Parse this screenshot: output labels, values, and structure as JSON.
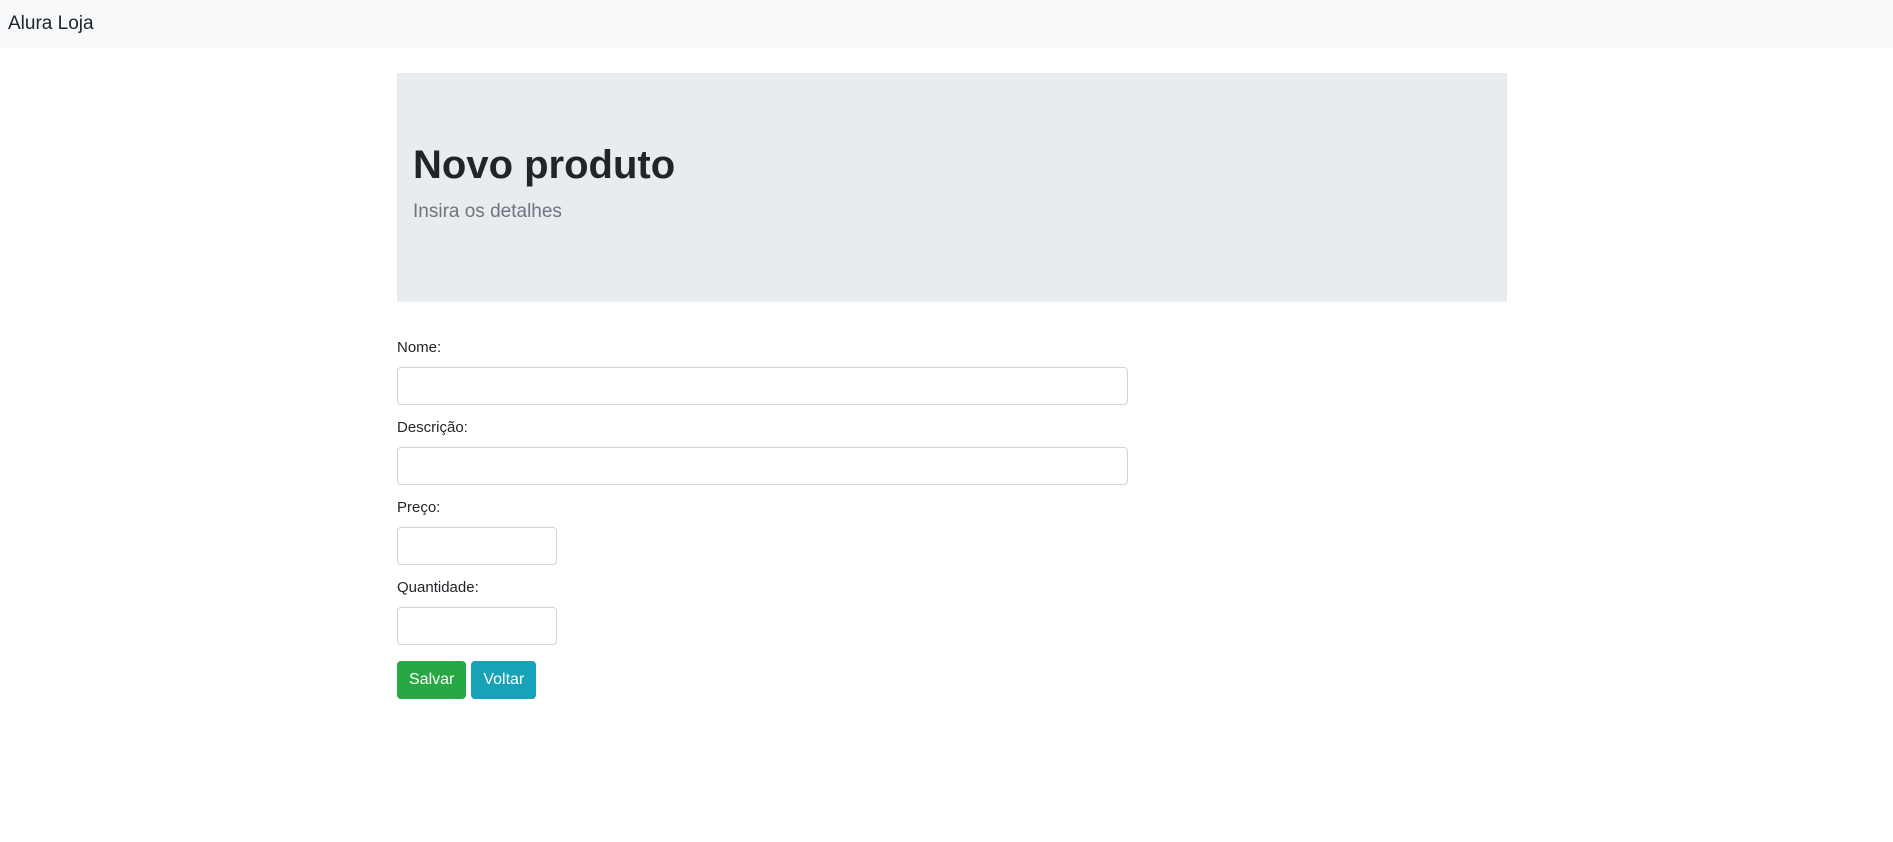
{
  "navbar": {
    "brand": "Alura Loja"
  },
  "header": {
    "title": "Novo produto",
    "subtitle": "Insira os detalhes"
  },
  "form": {
    "fields": [
      {
        "label": "Nome:",
        "value": "",
        "placeholder": ""
      },
      {
        "label": "Descrição:",
        "value": "",
        "placeholder": ""
      },
      {
        "label": "Preço:",
        "value": "",
        "placeholder": ""
      },
      {
        "label": "Quantidade:",
        "value": "",
        "placeholder": ""
      }
    ],
    "save_label": "Salvar",
    "back_label": "Voltar"
  },
  "colors": {
    "navbar_bg": "#f8f9fa",
    "jumbotron_bg": "#e9ecef",
    "save_button": "#28a745",
    "back_button": "#17a2b8"
  }
}
